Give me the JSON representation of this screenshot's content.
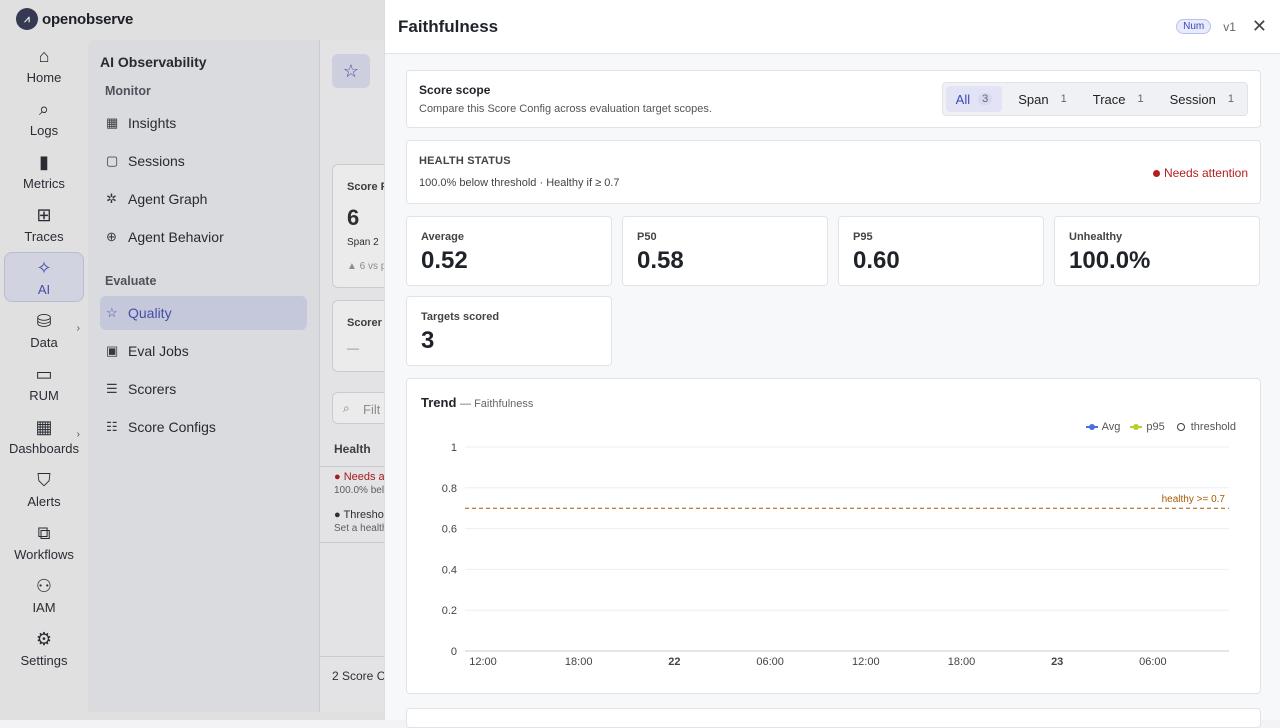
{
  "app": {
    "logo_text": "openobserve"
  },
  "nav": [
    {
      "label": "Home",
      "icon": "home-icon",
      "glyph": "⌂"
    },
    {
      "label": "Logs",
      "icon": "search-icon",
      "glyph": "⌕"
    },
    {
      "label": "Metrics",
      "icon": "bar-chart-icon",
      "glyph": "▮"
    },
    {
      "label": "Traces",
      "icon": "traces-icon",
      "glyph": "⊞"
    },
    {
      "label": "AI",
      "icon": "sparkle-icon",
      "glyph": "✧"
    },
    {
      "label": "Data",
      "icon": "database-icon",
      "glyph": "⛁"
    },
    {
      "label": "RUM",
      "icon": "devices-icon",
      "glyph": "▭"
    },
    {
      "label": "Dashboards",
      "icon": "dashboard-icon",
      "glyph": "▦"
    },
    {
      "label": "Alerts",
      "icon": "shield-alert-icon",
      "glyph": "⛉"
    },
    {
      "label": "Workflows",
      "icon": "workflow-icon",
      "glyph": "⧉"
    },
    {
      "label": "IAM",
      "icon": "user-gear-icon",
      "glyph": "⚇"
    },
    {
      "label": "Settings",
      "icon": "gear-icon",
      "glyph": "⚙"
    }
  ],
  "subnav": {
    "title": "AI Observability",
    "sections": [
      {
        "label": "Monitor",
        "items": [
          {
            "label": "Insights",
            "icon": "insights-icon",
            "glyph": "▦"
          },
          {
            "label": "Sessions",
            "icon": "chat-icon",
            "glyph": "▢"
          },
          {
            "label": "Agent Graph",
            "icon": "graph-icon",
            "glyph": "✲"
          },
          {
            "label": "Agent Behavior",
            "icon": "behavior-icon",
            "glyph": "⊕"
          }
        ]
      },
      {
        "label": "Evaluate",
        "items": [
          {
            "label": "Quality",
            "icon": "star-icon",
            "glyph": "☆"
          },
          {
            "label": "Eval Jobs",
            "icon": "calendar-icon",
            "glyph": "▣"
          },
          {
            "label": "Scorers",
            "icon": "checklist-icon",
            "glyph": "☰"
          },
          {
            "label": "Score Configs",
            "icon": "sliders-icon",
            "glyph": "☷"
          }
        ]
      }
    ]
  },
  "background": {
    "score_label": "Score F",
    "score_value": "6",
    "span_text": "Span 2",
    "delta_text": "▲ 6 vs p",
    "scorer_label": "Scorer",
    "scorer_value": "—",
    "filter_placeholder": "Filt",
    "health_header": "Health",
    "row1_status": "Needs a",
    "row1_sub": "100.0% bel",
    "row2_status": "Thresho",
    "row2_sub": "Set a health",
    "footer": "2 Score C"
  },
  "drawer": {
    "title": "Faithfulness",
    "badge": "Num",
    "version": "v1",
    "scope": {
      "title": "Score scope",
      "subtitle": "Compare this Score Config across evaluation target scopes.",
      "segments": [
        {
          "label": "All",
          "count": "3"
        },
        {
          "label": "Span",
          "count": "1"
        },
        {
          "label": "Trace",
          "count": "1"
        },
        {
          "label": "Session",
          "count": "1"
        }
      ]
    },
    "health": {
      "title": "HEALTH STATUS",
      "subtitle": "100.0% below threshold · Healthy if ≥ 0.7",
      "status": "Needs attention",
      "status_color": "#b41e1e"
    },
    "stats": [
      {
        "label": "Average",
        "value": "0.52"
      },
      {
        "label": "P50",
        "value": "0.58"
      },
      {
        "label": "P95",
        "value": "0.60"
      },
      {
        "label": "Unhealthy",
        "value": "100.0%"
      },
      {
        "label": "Targets scored",
        "value": "3"
      }
    ],
    "trend": {
      "title": "Trend",
      "subtitle": "— Faithfulness",
      "legend": [
        "Avg",
        "p95",
        "threshold"
      ]
    }
  },
  "chart_data": {
    "type": "line",
    "title": "Trend",
    "subtitle": "— Faithfulness",
    "x_ticks": [
      "12:00",
      "18:00",
      "22",
      "06:00",
      "12:00",
      "18:00",
      "23",
      "06:00"
    ],
    "x_ticks_bold": [
      false,
      false,
      true,
      false,
      false,
      false,
      true,
      false
    ],
    "y_ticks": [
      "0",
      "0.2",
      "0.4",
      "0.6",
      "0.8",
      "1"
    ],
    "ylim": [
      0,
      1
    ],
    "grid": true,
    "legend_position": "top-right",
    "series": [
      {
        "name": "Avg",
        "color": "#4a6fe0",
        "values": []
      },
      {
        "name": "p95",
        "color": "#b9cc30",
        "values": []
      }
    ],
    "threshold": {
      "name": "threshold",
      "value": 0.7,
      "label": "healthy >= 0.7",
      "color": "#a65a00"
    }
  }
}
